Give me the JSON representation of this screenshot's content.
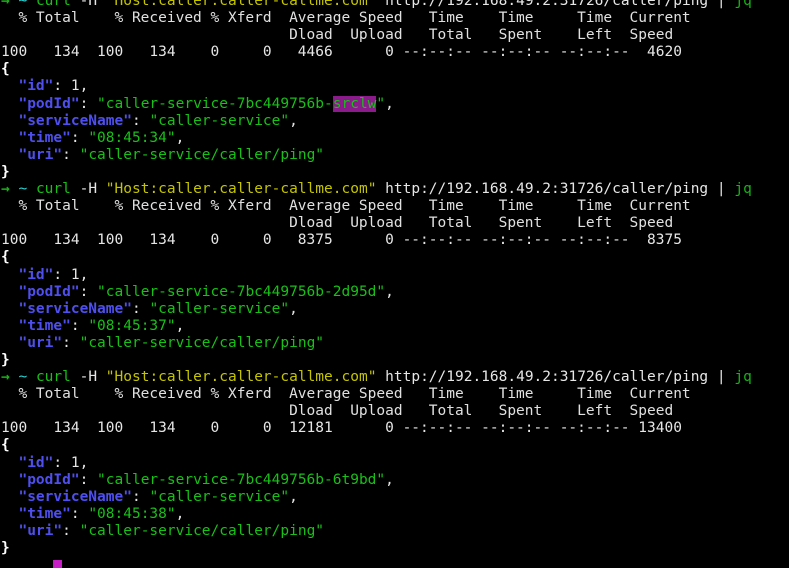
{
  "terminal": {
    "background_color": "#000000",
    "foreground_color": "#e6e6e6",
    "accent_prompt_color": "#18b218",
    "string_color": "#18c018",
    "key_color": "#4f4fef",
    "host_arg_color": "#c4c400",
    "highlight_bg_color": "#8b1a8b",
    "cursor_color": "#c81ec8",
    "clipped_top_line": "}"
  },
  "prompt": {
    "arrow": "→",
    "cwd": "~",
    "command_name": "curl",
    "flag": "-H",
    "header_arg": "\"Host:caller.caller-callme.com\"",
    "url": "http://192.168.49.2:31726/caller/ping",
    "pipe": "|",
    "pipe_target": "jq"
  },
  "curl_progress_header": {
    "row1": "  % Total    % Received % Xferd  Average Speed   Time    Time     Time  Current",
    "row2": "                                 Dload  Upload   Total   Spent    Left  Speed"
  },
  "runs": [
    {
      "stats": "100   134  100   134    0     0   4466      0 --:--:-- --:--:-- --:--:--  4620",
      "stats_fields": {
        "percent_total": "100",
        "total": "134",
        "percent_received": "100",
        "received": "134",
        "percent_xferd": "0",
        "xferd": "0",
        "dload": "4466",
        "upload": "0",
        "time_total": "--:--:--",
        "time_spent": "--:--:--",
        "time_left": "--:--:--",
        "current_speed": "4620"
      },
      "json": {
        "open_brace": "{",
        "close_brace": "}",
        "fields": [
          {
            "key": "\"id\"",
            "sep": ": ",
            "value": "1",
            "value_type": "number",
            "trailing": ","
          },
          {
            "key": "\"podId\"",
            "sep": ": ",
            "value_prefix": "\"caller-service-7bc449756b-",
            "value_highlight": "srclw",
            "value_suffix": "\"",
            "value_type": "string-highlighted",
            "trailing": ","
          },
          {
            "key": "\"serviceName\"",
            "sep": ": ",
            "value": "\"caller-service\"",
            "value_type": "string",
            "trailing": ","
          },
          {
            "key": "\"time\"",
            "sep": ": ",
            "value": "\"08:45:34\"",
            "value_type": "string",
            "trailing": ","
          },
          {
            "key": "\"uri\"",
            "sep": ": ",
            "value": "\"caller-service/caller/ping\"",
            "value_type": "string",
            "trailing": ""
          }
        ]
      }
    },
    {
      "stats": "100   134  100   134    0     0   8375      0 --:--:-- --:--:-- --:--:--  8375",
      "stats_fields": {
        "percent_total": "100",
        "total": "134",
        "percent_received": "100",
        "received": "134",
        "percent_xferd": "0",
        "xferd": "0",
        "dload": "8375",
        "upload": "0",
        "time_total": "--:--:--",
        "time_spent": "--:--:--",
        "time_left": "--:--:--",
        "current_speed": "8375"
      },
      "json": {
        "open_brace": "{",
        "close_brace": "}",
        "fields": [
          {
            "key": "\"id\"",
            "sep": ": ",
            "value": "1",
            "value_type": "number",
            "trailing": ","
          },
          {
            "key": "\"podId\"",
            "sep": ": ",
            "value": "\"caller-service-7bc449756b-2d95d\"",
            "value_type": "string",
            "trailing": ","
          },
          {
            "key": "\"serviceName\"",
            "sep": ": ",
            "value": "\"caller-service\"",
            "value_type": "string",
            "trailing": ","
          },
          {
            "key": "\"time\"",
            "sep": ": ",
            "value": "\"08:45:37\"",
            "value_type": "string",
            "trailing": ","
          },
          {
            "key": "\"uri\"",
            "sep": ": ",
            "value": "\"caller-service/caller/ping\"",
            "value_type": "string",
            "trailing": ""
          }
        ]
      }
    },
    {
      "stats": "100   134  100   134    0     0  12181      0 --:--:-- --:--:-- --:--:-- 13400",
      "stats_fields": {
        "percent_total": "100",
        "total": "134",
        "percent_received": "100",
        "received": "134",
        "percent_xferd": "0",
        "xferd": "0",
        "dload": "12181",
        "upload": "0",
        "time_total": "--:--:--",
        "time_spent": "--:--:--",
        "time_left": "--:--:--",
        "current_speed": "13400"
      },
      "json": {
        "open_brace": "{",
        "close_brace": "}",
        "fields": [
          {
            "key": "\"id\"",
            "sep": ": ",
            "value": "1",
            "value_type": "number",
            "trailing": ","
          },
          {
            "key": "\"podId\"",
            "sep": ": ",
            "value": "\"caller-service-7bc449756b-6t9bd\"",
            "value_type": "string",
            "trailing": ","
          },
          {
            "key": "\"serviceName\"",
            "sep": ": ",
            "value": "\"caller-service\"",
            "value_type": "string",
            "trailing": ","
          },
          {
            "key": "\"time\"",
            "sep": ": ",
            "value": "\"08:45:38\"",
            "value_type": "string",
            "trailing": ","
          },
          {
            "key": "\"uri\"",
            "sep": ": ",
            "value": "\"caller-service/caller/ping\"",
            "value_type": "string",
            "trailing": ""
          }
        ]
      }
    }
  ]
}
